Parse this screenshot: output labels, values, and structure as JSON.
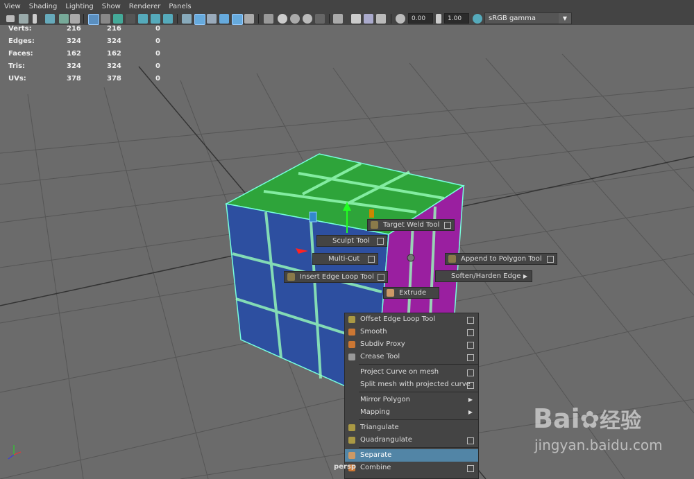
{
  "menubar": [
    "View",
    "Shading",
    "Lighting",
    "Show",
    "Renderer",
    "Panels"
  ],
  "toolbar": {
    "exposure": "0.00",
    "gamma": "1.00",
    "color_space": "sRGB gamma"
  },
  "hud": {
    "rows": [
      {
        "label": "Verts:",
        "a": "216",
        "b": "216",
        "c": "0"
      },
      {
        "label": "Edges:",
        "a": "324",
        "b": "324",
        "c": "0"
      },
      {
        "label": "Faces:",
        "a": "162",
        "b": "162",
        "c": "0"
      },
      {
        "label": "Tris:",
        "a": "324",
        "b": "324",
        "c": "0"
      },
      {
        "label": "UVs:",
        "a": "378",
        "b": "378",
        "c": "0"
      }
    ]
  },
  "marking_menu": {
    "target_weld": "Target Weld Tool",
    "sculpt": "Sculpt Tool",
    "multicut": "Multi-Cut",
    "insert_edge_loop": "Insert Edge Loop Tool",
    "extrude": "Extrude",
    "append_polygon": "Append to Polygon Tool",
    "soften_harden": "Soften/Harden Edge"
  },
  "menu": {
    "items": [
      "Offset Edge Loop Tool",
      "Smooth",
      "Subdiv Proxy",
      "Crease Tool",
      "Project Curve on mesh",
      "Split mesh with projected curve",
      "Mirror Polygon",
      "Mapping",
      "Triangulate",
      "Quadrangulate",
      "Separate",
      "Combine"
    ]
  },
  "viewport_label": "persp",
  "watermark": {
    "brand": "Bai",
    "brand2": "经验",
    "url": "jingyan.baidu.com"
  },
  "colors": {
    "accent": "#5285a6",
    "green": "#2ea43a",
    "blue": "#2d4fa0",
    "purple": "#9a1fa0"
  }
}
